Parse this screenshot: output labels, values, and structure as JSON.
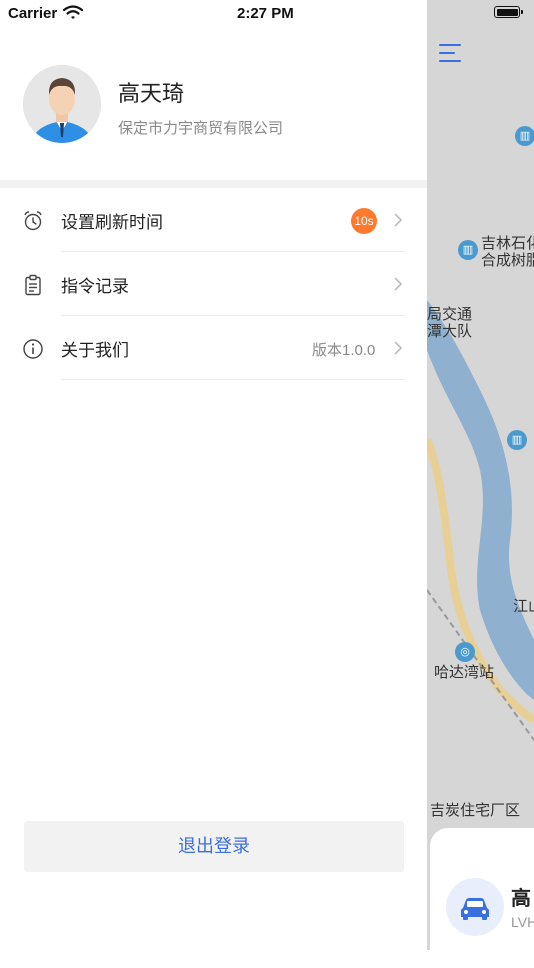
{
  "status_bar": {
    "carrier": "Carrier",
    "time": "2:27 PM",
    "icons": [
      "wifi-icon",
      "battery-icon"
    ]
  },
  "profile": {
    "name": "高天琦",
    "company": "保定市力宇商贸有限公司",
    "avatar_icon": "avatar-icon"
  },
  "menu": {
    "items": [
      {
        "label": "设置刷新时间",
        "icon": "alarm-clock-icon",
        "badge": "10s"
      },
      {
        "label": "指令记录",
        "icon": "clipboard-icon"
      },
      {
        "label": "关于我们",
        "icon": "info-icon",
        "value": "版本1.0.0"
      }
    ]
  },
  "logout_label": "退出登录",
  "map": {
    "labels": [
      "吉林石化",
      "合成树脂",
      "局交通",
      "潭大队",
      "哈达湾站",
      "江山",
      "吉炭住宅厂区"
    ],
    "vehicle": {
      "name": "高",
      "sub": "LVH",
      "icon": "car-icon"
    }
  },
  "colors": {
    "accent": "#3b6fe0",
    "badge": "#ff7a2e",
    "river": "#8fb0cf",
    "road": "#e8cf95",
    "map_bg": "#d6d6d6"
  }
}
